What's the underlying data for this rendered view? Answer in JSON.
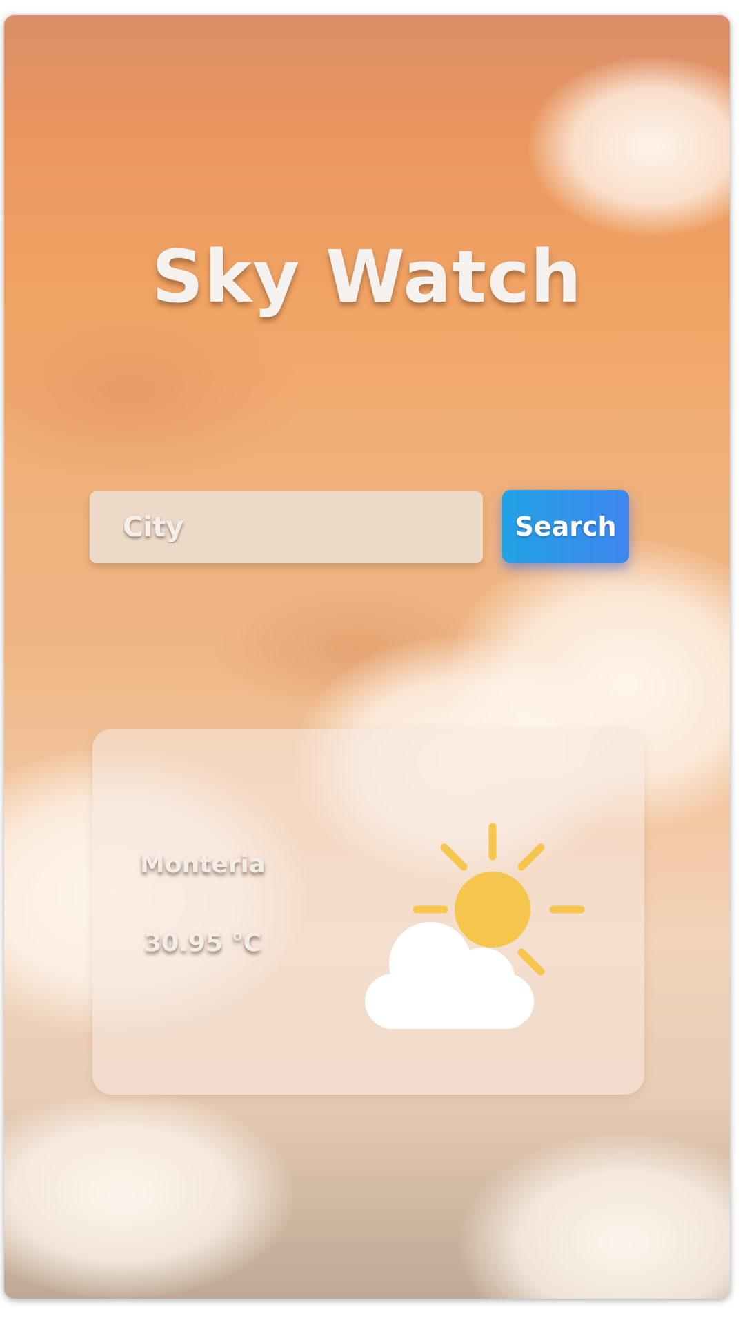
{
  "app": {
    "title": "Sky Watch"
  },
  "search": {
    "placeholder": "City",
    "value": "",
    "button_label": "Search"
  },
  "weather": {
    "city": "Monteria",
    "temperature": "30.95 ℃",
    "icon": "partly-cloudy-icon"
  },
  "colors": {
    "button_gradient_start": "#22a2e6",
    "button_gradient_end": "#3f86ee",
    "sun": "#f5c54d",
    "cloud": "#ffffff",
    "background_top": "#d98f6a",
    "background_bottom": "#bfa995"
  }
}
